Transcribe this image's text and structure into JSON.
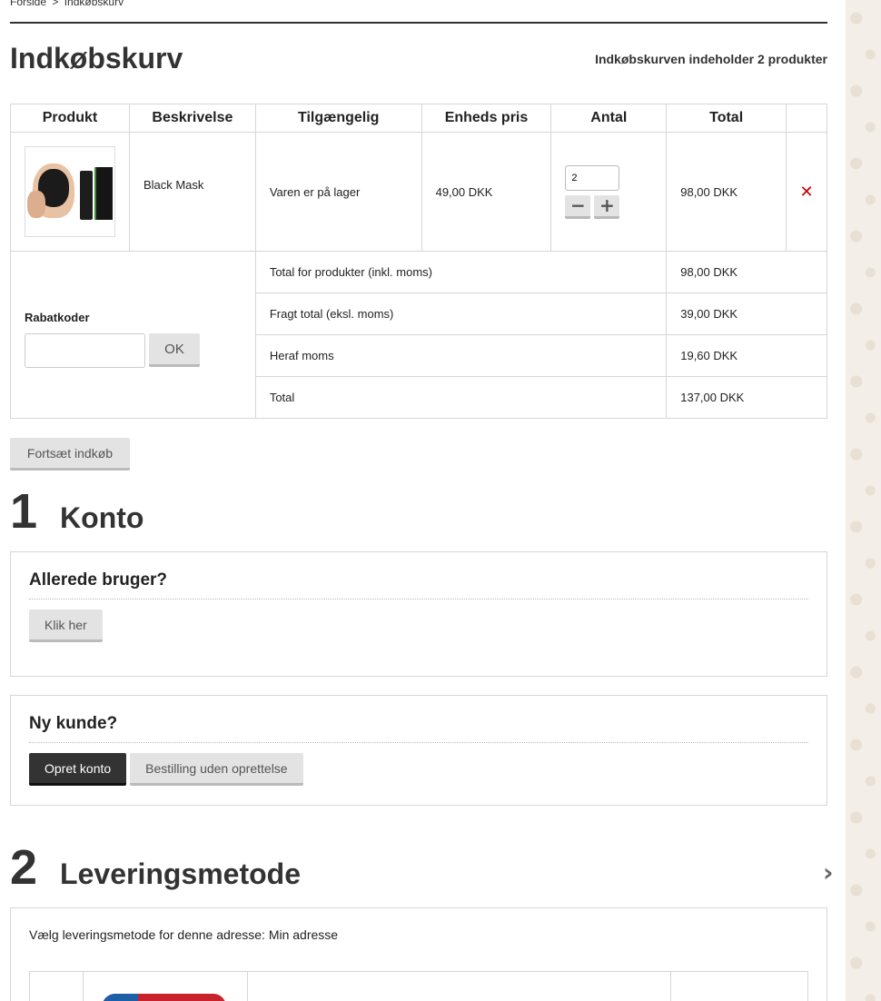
{
  "breadcrumb": {
    "home": "Forside",
    "sep": ">",
    "current": "Indkøbskurv"
  },
  "page": {
    "title": "Indkøbskurv",
    "cart_count_text": "Indkøbskurven indeholder 2 produkter"
  },
  "cart_table": {
    "headers": [
      "Produkt",
      "Beskrivelse",
      "Tilgængelig",
      "Enheds pris",
      "Antal",
      "Total"
    ],
    "items": [
      {
        "image_icon": "black-mask-product-image",
        "description": "Black Mask",
        "availability": "Varen er på lager",
        "unit_price": "49,00 DKK",
        "quantity": "2",
        "total": "98,00 DKK",
        "minus_label": "−",
        "plus_label": "+",
        "remove_label": "✕"
      }
    ],
    "summary": [
      {
        "label": "Total for produkter (inkl. moms)",
        "value": "98,00 DKK"
      },
      {
        "label": "Fragt total (eksl. moms)",
        "value": "39,00 DKK"
      },
      {
        "label": "Heraf moms",
        "value": "19,60 DKK"
      },
      {
        "label": "Total",
        "value": "137,00 DKK"
      }
    ],
    "coupon": {
      "label": "Rabatkoder",
      "input_value": "",
      "button_label": "OK"
    }
  },
  "continue_button": "Fortsæt indkøb",
  "step1": {
    "number": "1",
    "title": "Konto",
    "existing": {
      "heading": "Allerede bruger?",
      "button": "Klik her"
    },
    "new": {
      "heading": "Ny kunde?",
      "create_button": "Opret konto",
      "guest_button": "Bestilling uden oprettelse"
    }
  },
  "step2": {
    "number": "2",
    "title": "Leveringsmetode",
    "arrow_icon": "chevron-right-icon",
    "instruction": "Vælg leveringsmetode for denne adresse: Min adresse"
  },
  "colors": {
    "remove": "#c40000",
    "dark_button": "#333333",
    "border": "#d6d6d6"
  }
}
